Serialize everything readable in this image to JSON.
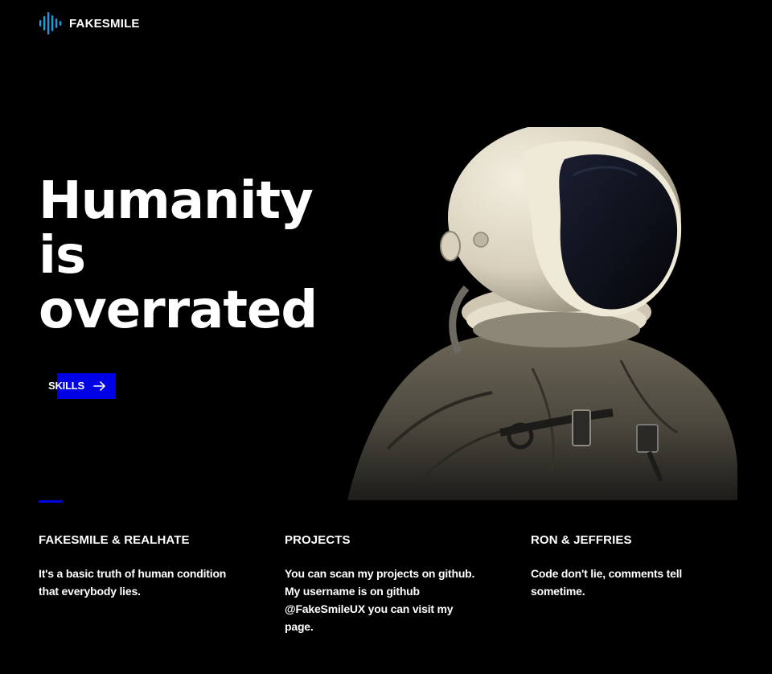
{
  "brand": {
    "name": "FAKESMILE",
    "accent": "#0000e6",
    "logo_gradient": [
      "#1ec8c8",
      "#2a6cf0"
    ]
  },
  "hero": {
    "title_lines": [
      "Humanity",
      "is",
      "overrated"
    ],
    "cta_label": "SKILLS",
    "cta_icon": "arrow-right-icon",
    "image": "astronaut-photo"
  },
  "columns": [
    {
      "title": "FAKESMILE & REALHATE",
      "text": "It's a basic truth of human condition that everybody lies."
    },
    {
      "title": "PROJECTS",
      "text": "You can scan my projects on github. My username is on github @FakeSmileUX you can visit my page."
    },
    {
      "title": "RON & JEFFRIES",
      "text": "Code don't lie, comments tell sometime."
    }
  ]
}
